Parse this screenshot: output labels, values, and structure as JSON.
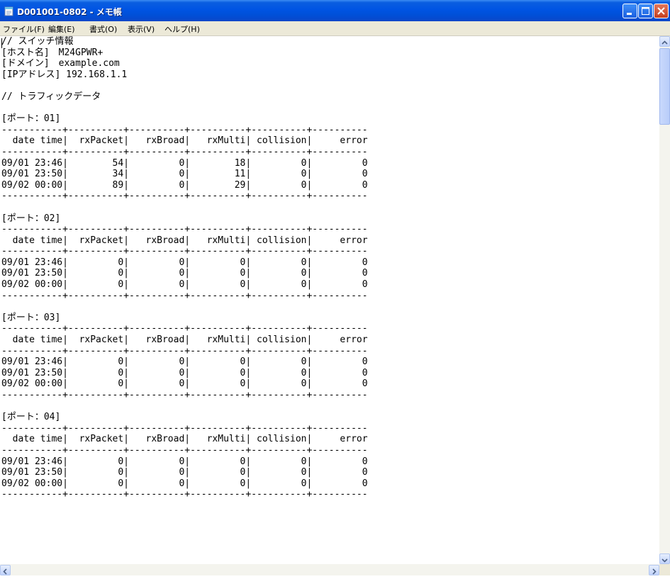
{
  "window": {
    "title": "D001001-0802 - メモ帳"
  },
  "menu": {
    "items": [
      "ファイル(F)",
      "編集(E)",
      "書式(O)",
      "表示(V)",
      "ヘルプ(H)"
    ]
  },
  "document": {
    "text": "// スイッチ情報\n[ホスト名]　M24GPWR+\n[ドメイン]　example.com\n[IPアドレス] 192.168.1.1\n\n// トラフィックデータ\n\n[ポート：01]\n-----------+----------+----------+----------+----------+----------\n  date time|  rxPacket|   rxBroad|   rxMulti| collision|     error\n-----------+----------+----------+----------+----------+----------\n09/01 23:46|        54|         0|        18|         0|         0\n09/01 23:50|        34|         0|        11|         0|         0\n09/02 00:00|        89|         0|        29|         0|         0\n-----------+----------+----------+----------+----------+----------\n\n[ポート：02]\n-----------+----------+----------+----------+----------+----------\n  date time|  rxPacket|   rxBroad|   rxMulti| collision|     error\n-----------+----------+----------+----------+----------+----------\n09/01 23:46|         0|         0|         0|         0|         0\n09/01 23:50|         0|         0|         0|         0|         0\n09/02 00:00|         0|         0|         0|         0|         0\n-----------+----------+----------+----------+----------+----------\n\n[ポート：03]\n-----------+----------+----------+----------+----------+----------\n  date time|  rxPacket|   rxBroad|   rxMulti| collision|     error\n-----------+----------+----------+----------+----------+----------\n09/01 23:46|         0|         0|         0|         0|         0\n09/01 23:50|         0|         0|         0|         0|         0\n09/02 00:00|         0|         0|         0|         0|         0\n-----------+----------+----------+----------+----------+----------\n\n[ポート：04]\n-----------+----------+----------+----------+----------+----------\n  date time|  rxPacket|   rxBroad|   rxMulti| collision|     error\n-----------+----------+----------+----------+----------+----------\n09/01 23:46|         0|         0|         0|         0|         0\n09/01 23:50|         0|         0|         0|         0|         0\n09/02 00:00|         0|         0|         0|         0|         0\n-----------+----------+----------+----------+----------+----------"
  },
  "icons": {
    "app": "notepad-icon",
    "minimize": "minimize-icon",
    "maximize": "maximize-icon",
    "close": "close-icon"
  },
  "colors": {
    "titlebar": "#0054e3",
    "close_button": "#c5401f",
    "chrome": "#ece9d8"
  }
}
